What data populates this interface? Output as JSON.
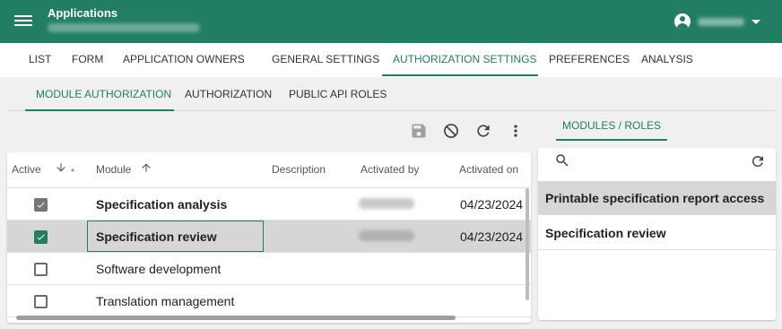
{
  "app": {
    "title": "Applications"
  },
  "main_tabs": [
    {
      "label": "LIST"
    },
    {
      "label": "FORM"
    },
    {
      "label": "APPLICATION OWNERS"
    },
    {
      "label": "GENERAL SETTINGS"
    },
    {
      "label": "AUTHORIZATION SETTINGS",
      "active": true
    },
    {
      "label": "PREFERENCES"
    },
    {
      "label": "ANALYSIS"
    }
  ],
  "sub_tabs": [
    {
      "label": "MODULE AUTHORIZATION",
      "active": true
    },
    {
      "label": "AUTHORIZATION"
    },
    {
      "label": "PUBLIC API ROLES"
    }
  ],
  "toolbar": {
    "icons": [
      "save-icon",
      "block-icon",
      "refresh-icon",
      "more-vert-icon"
    ]
  },
  "grid": {
    "columns": {
      "active": "Active",
      "active_required": "*",
      "module": "Module",
      "description": "Description",
      "activated_by": "Activated by",
      "activated_on": "Activated on"
    },
    "rows": [
      {
        "module": "Specification analysis",
        "activated_on": "04/23/2024",
        "active": true,
        "bold": true
      },
      {
        "module": "Specification review",
        "activated_on": "04/23/2024",
        "active": true,
        "bold": true,
        "selected": true
      },
      {
        "module": "Software development",
        "activated_on": "",
        "active": false,
        "bold": false
      },
      {
        "module": "Translation management",
        "activated_on": "",
        "active": false,
        "bold": false
      }
    ]
  },
  "right_panel": {
    "tab_label": "MODULES / ROLES",
    "items": [
      {
        "label": "Printable specification report access",
        "selected": true
      },
      {
        "label": "Specification review",
        "selected": false
      }
    ]
  },
  "colors": {
    "primary": "#217e63",
    "selected_row": "#d6d6d6",
    "required": "#d32f2f"
  }
}
